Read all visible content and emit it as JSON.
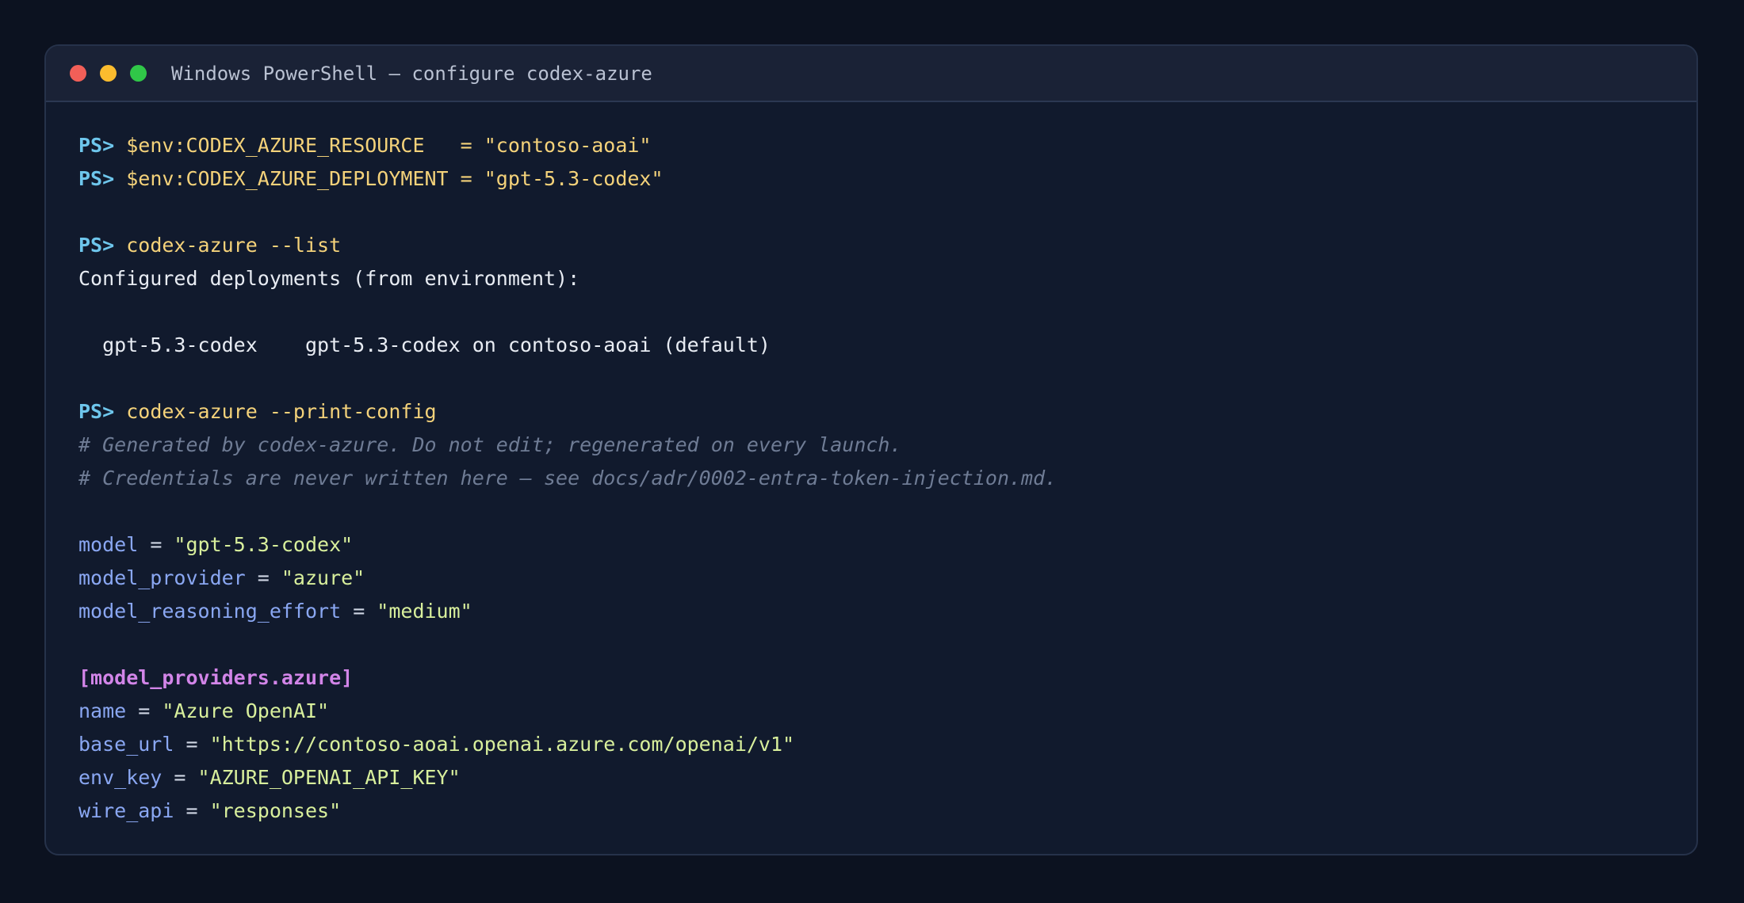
{
  "window": {
    "title": "Windows PowerShell — configure codex-azure",
    "controls": {
      "close_color": "#f25f58",
      "minimize_color": "#fbbc2e",
      "maximize_color": "#30c748"
    }
  },
  "terminal": {
    "prompt": "PS>",
    "env_resource_cmd": "$env:CODEX_AZURE_RESOURCE   = \"contoso-aoai\"",
    "env_deployment_cmd": "$env:CODEX_AZURE_DEPLOYMENT = \"gpt-5.3-codex\"",
    "list_cmd": "codex-azure --list",
    "list_header": "Configured deployments (from environment):",
    "deployment_row": "  gpt-5.3-codex    gpt-5.3-codex on contoso-aoai (default)",
    "print_config_cmd": "codex-azure --print-config",
    "comment_1": "# Generated by codex-azure. Do not edit; regenerated on every launch.",
    "comment_2": "# Credentials are never written here — see docs/adr/0002-entra-token-injection.md.",
    "config": [
      {
        "key": "model",
        "value": "\"gpt-5.3-codex\""
      },
      {
        "key": "model_provider",
        "value": "\"azure\""
      },
      {
        "key": "model_reasoning_effort",
        "value": "\"medium\""
      }
    ],
    "section_header": "[model_providers.azure]",
    "provider": [
      {
        "key": "name",
        "value": "\"Azure OpenAI\""
      },
      {
        "key": "base_url",
        "value": "\"https://contoso-aoai.openai.azure.com/openai/v1\""
      },
      {
        "key": "env_key",
        "value": "\"AZURE_OPENAI_API_KEY\""
      },
      {
        "key": "wire_api",
        "value": "\"responses\""
      }
    ],
    "equals": " = "
  }
}
